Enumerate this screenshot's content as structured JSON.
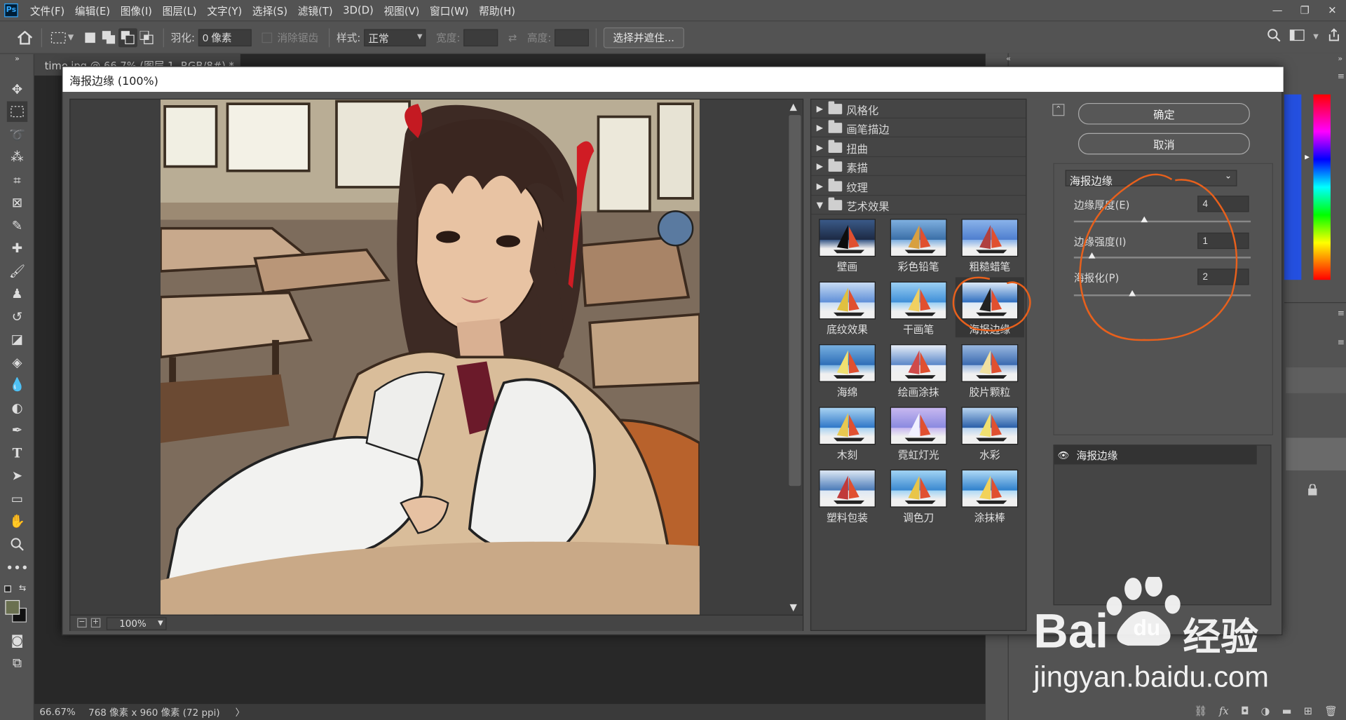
{
  "app": {
    "logo": "Ps",
    "menu": [
      "文件(F)",
      "编辑(E)",
      "图像(I)",
      "图层(L)",
      "文字(Y)",
      "选择(S)",
      "滤镜(T)",
      "3D(D)",
      "视图(V)",
      "窗口(W)",
      "帮助(H)"
    ],
    "window_controls": [
      "—",
      "❐",
      "✕"
    ]
  },
  "options": {
    "feather_label": "羽化:",
    "feather_value": "0 像素",
    "antialias_label": "消除锯齿",
    "style_label": "样式:",
    "style_value": "正常",
    "width_label": "宽度:",
    "height_label": "高度:",
    "select_mask_button": "选择并遮住..."
  },
  "document": {
    "tab_title": "timo.jpg @ 66.7% (图层 1, RGB/8#) *",
    "zoom": "66.67%",
    "size_info": "768 像素 x 960 像素 (72 ppi)"
  },
  "dialog": {
    "title": "海报边缘 (100%)",
    "zoom_value": "100%",
    "ok_label": "确定",
    "cancel_label": "取消",
    "selected_filter": "海报边缘",
    "categories": [
      {
        "name": "风格化",
        "expanded": false
      },
      {
        "name": "画笔描边",
        "expanded": false
      },
      {
        "name": "扭曲",
        "expanded": false
      },
      {
        "name": "素描",
        "expanded": false
      },
      {
        "name": "纹理",
        "expanded": false
      },
      {
        "name": "艺术效果",
        "expanded": true
      }
    ],
    "filters": [
      "壁画",
      "彩色铅笔",
      "粗糙蜡笔",
      "底纹效果",
      "干画笔",
      "海报边缘",
      "海绵",
      "绘画涂抹",
      "胶片颗粒",
      "木刻",
      "霓虹灯光",
      "水彩",
      "塑料包装",
      "调色刀",
      "涂抹棒"
    ],
    "params": [
      {
        "label": "边缘厚度(E)",
        "value": "4",
        "fraction": 0.4
      },
      {
        "label": "边缘强度(I)",
        "value": "1",
        "fraction": 0.1
      },
      {
        "label": "海报化(P)",
        "value": "2",
        "fraction": 0.33
      }
    ],
    "layer_name": "海报边缘"
  },
  "watermark": {
    "brand": "Bai",
    "brand_cn": "经验",
    "url": "jingyan.baidu.com"
  },
  "colors": {
    "annotation": "#e8601c",
    "panel": "#535353"
  }
}
